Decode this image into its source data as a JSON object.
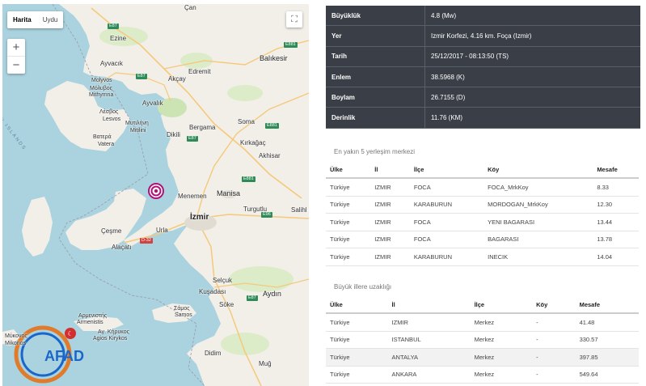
{
  "map": {
    "map_type_options": [
      "Harita",
      "Uydu"
    ],
    "selected_map_type": "Harita",
    "zoom_in": "+",
    "zoom_out": "−",
    "fullscreen": "⛶",
    "logo_text": "AFAD",
    "cities": {
      "can": "Çan",
      "ezine": "Ezine",
      "ayvacik": "Ayvacık",
      "molyvos": "Μόλυβος",
      "molyvos_latin": "Molyvos",
      "mithymna": "Μήθυμνα",
      "mithymna_latin": "Mithymna",
      "lesvos": "Λέσβος",
      "lesvos_latin": "Lesvos",
      "mytilini": "Μυτιλήνη",
      "mytilini_latin": "Mitilini",
      "vatera": "Βατερά",
      "vatera_latin": "Vatera",
      "edremit": "Edremit",
      "akcay": "Akçay",
      "ayvalik": "Ayvalık",
      "balikesir": "Balıkesir",
      "soma": "Soma",
      "kirkagac": "Kırkağaç",
      "akhisar": "Akhisar",
      "dikili": "Dikili",
      "bergama": "Bergama",
      "menemen": "Menemen",
      "manisa": "Manisa",
      "turgutlu": "Turgutlu",
      "salihli": "Salihl",
      "izmir": "İzmir",
      "urla": "Urla",
      "cesme": "Çeşme",
      "alacati": "Alaçatı",
      "selcuk": "Selçuk",
      "kusadasi": "Kuşadası",
      "aydin": "Aydın",
      "soke": "Söke",
      "samos": "Σάμος",
      "samos_latin": "Samos",
      "armenistis": "Αρμενιστής",
      "armenistis_latin": "Armenistis",
      "agios_kirykos": "Αγ. Κήρυκος",
      "agios_kirykos_latin": "Agios Kirykos",
      "mykonos": "Μύκονος",
      "mykonos_latin": "Mikonos",
      "didim": "Didim",
      "mugla": "Muğ"
    },
    "water_label": "AN ISLANDS",
    "roads": [
      "E87",
      "E87",
      "E87",
      "E87",
      "E881",
      "E881",
      "E881",
      "E96",
      "D-32",
      "E87"
    ]
  },
  "details": [
    {
      "key": "Büyüklük",
      "value": "4.8 (Mw)"
    },
    {
      "key": "Yer",
      "value": "Izmir Korfezi, 4.16 km. Foça (Izmir)"
    },
    {
      "key": "Tarih",
      "value": "25/12/2017 - 08:13:50 (TS)"
    },
    {
      "key": "Enlem",
      "value": "38.5968 (K)"
    },
    {
      "key": "Boylam",
      "value": "26.7155 (D)"
    },
    {
      "key": "Derinlik",
      "value": "11.76 (KM)"
    }
  ],
  "nearest": {
    "title": "En yakın 5 yerleşim merkezi",
    "headers": [
      "Ülke",
      "İl",
      "İlçe",
      "Köy",
      "Mesafe"
    ],
    "rows": [
      [
        "Türkiye",
        "IZMIR",
        "FOCA",
        "FOCA_MrkKoy",
        "8.33"
      ],
      [
        "Türkiye",
        "IZMIR",
        "KARABURUN",
        "MORDOGAN_MrkKoy",
        "12.30"
      ],
      [
        "Türkiye",
        "IZMIR",
        "FOCA",
        "YENI BAGARASI",
        "13.44"
      ],
      [
        "Türkiye",
        "IZMIR",
        "FOCA",
        "BAGARASI",
        "13.78"
      ],
      [
        "Türkiye",
        "IZMIR",
        "KARABURUN",
        "INECIK",
        "14.04"
      ]
    ]
  },
  "cities_distance": {
    "title": "Büyük illere uzaklığı",
    "headers": [
      "Ülke",
      "İl",
      "İlçe",
      "Köy",
      "Mesafe"
    ],
    "rows": [
      [
        "Türkiye",
        "IZMIR",
        "Merkez",
        "-",
        "41.48"
      ],
      [
        "Türkiye",
        "ISTANBUL",
        "Merkez",
        "-",
        "330.57"
      ],
      [
        "Türkiye",
        "ANTALYA",
        "Merkez",
        "-",
        "397.85"
      ],
      [
        "Türkiye",
        "ANKARA",
        "Merkez",
        "-",
        "549.64"
      ]
    ]
  },
  "colors": {
    "table_dark": "#3a3f47",
    "water": "#aad3df",
    "land": "#f2efe9",
    "epicenter": "#b0127a",
    "afad_blue": "#1b66c9",
    "afad_orange": "#e07b2b"
  }
}
